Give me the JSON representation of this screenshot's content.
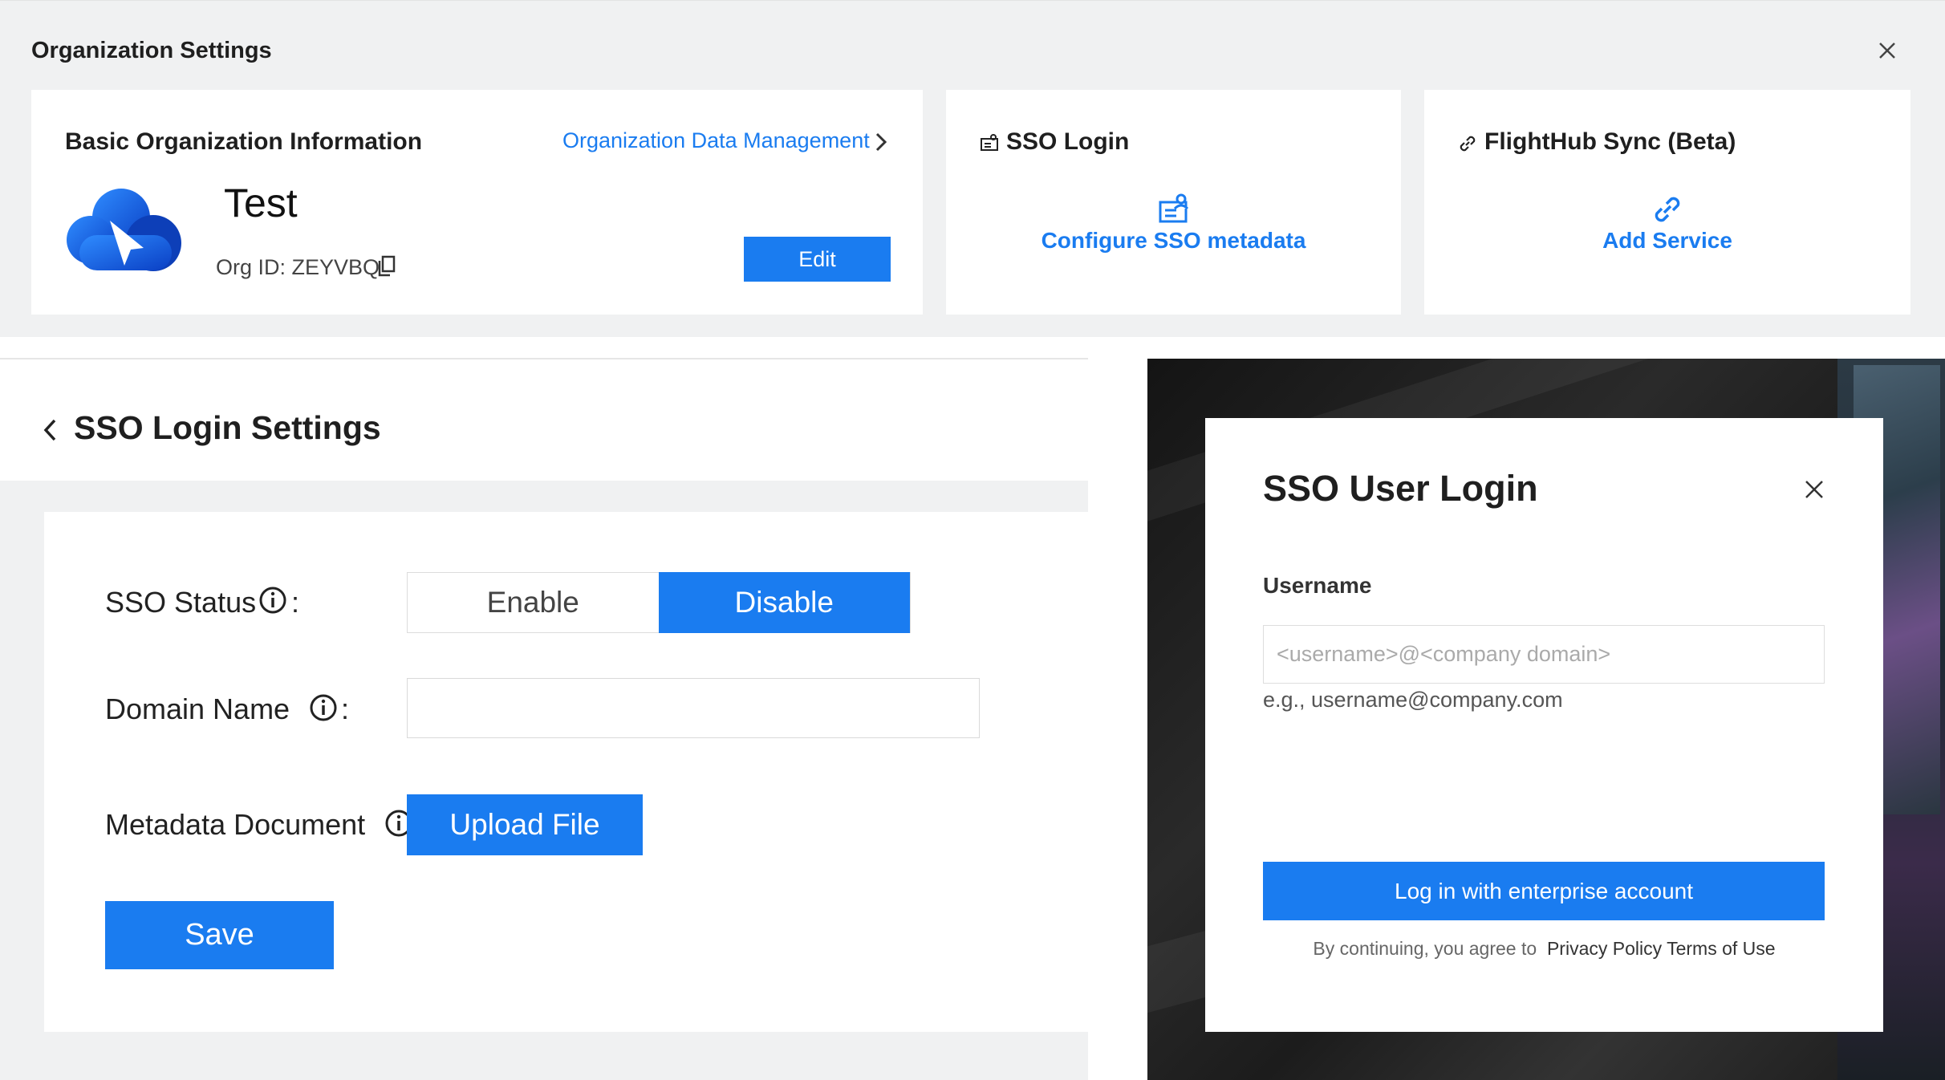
{
  "org_settings": {
    "title": "Organization Settings",
    "basic_info": {
      "title": "Basic Organization Information",
      "data_management_link": "Organization Data Management",
      "org_name": "Test",
      "org_id": "Org ID: ZEYVBQ",
      "edit_label": "Edit"
    },
    "sso_card": {
      "title": "SSO Login",
      "action_label": "Configure SSO metadata"
    },
    "flighthub_card": {
      "title": "FlightHub Sync (Beta)",
      "action_label": "Add Service"
    }
  },
  "sso_settings": {
    "heading": "SSO Login Settings",
    "status_label": "SSO Status",
    "status_options": [
      "Enable",
      "Disable"
    ],
    "status_selected": "Disable",
    "domain_label": "Domain Name",
    "domain_value": "",
    "colon": ":",
    "metadata_label": "Metadata Document",
    "upload_label": "Upload File",
    "save_label": "Save"
  },
  "sso_login_dialog": {
    "title": "SSO User Login",
    "username_label": "Username",
    "username_placeholder": "<username>@<company domain>",
    "username_hint": "e.g., username@company.com",
    "login_button": "Log in with enterprise account",
    "agree_prefix": "By continuing, you agree to",
    "privacy_link": "Privacy Policy",
    "terms_link": "Terms of Use"
  },
  "colors": {
    "accent": "#1a7cf0",
    "panel_bg": "#f0f1f2"
  },
  "icons": [
    "close-icon",
    "chevron-right-icon",
    "cloud-logo",
    "copy-icon",
    "sso-icon",
    "link-icon",
    "chevron-left-icon",
    "info-icon"
  ]
}
